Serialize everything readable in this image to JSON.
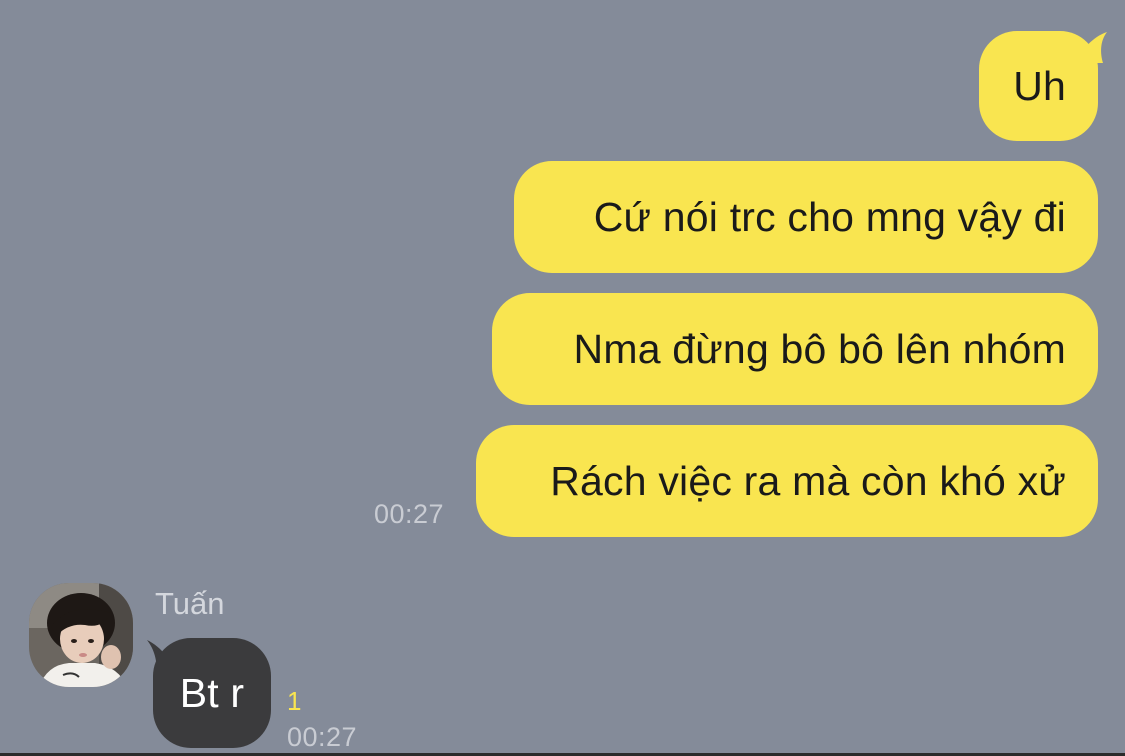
{
  "colors": {
    "background": "#848b99",
    "outgoing_bubble": "#f9e550",
    "incoming_bubble": "#3b3b3d",
    "unread_badge": "#f9e550"
  },
  "outgoing": [
    {
      "text": "Uh"
    },
    {
      "text": "Cứ nói trc cho mng vậy đi"
    },
    {
      "text": "Nma đừng bô bô lên nhóm"
    },
    {
      "text": "Rách việc ra mà còn khó xử"
    }
  ],
  "outgoing_time": "00:27",
  "incoming": {
    "sender": "Tuấn",
    "avatar_icon": "avatar-icon",
    "text": "Bt r",
    "unread_count": "1",
    "time": "00:27"
  }
}
